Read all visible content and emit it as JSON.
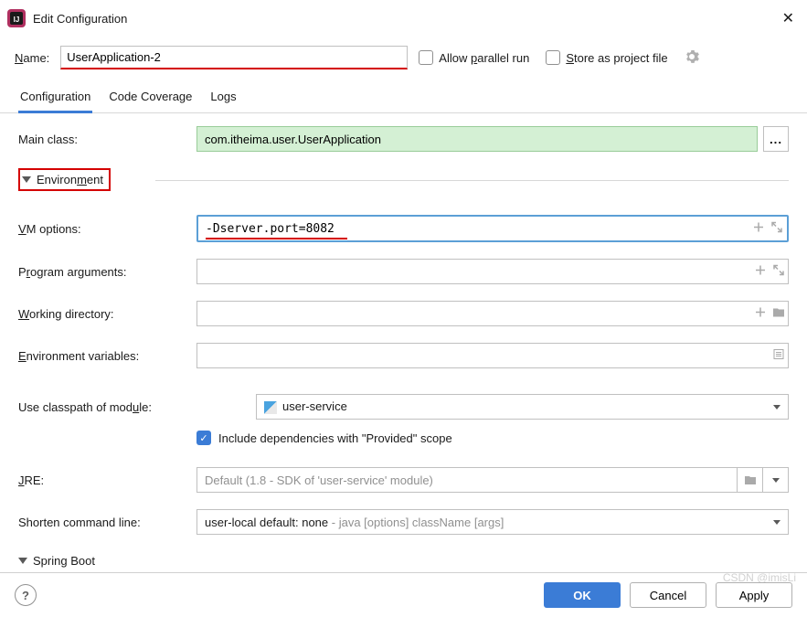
{
  "title": "Edit Configuration",
  "name_label": "Name:",
  "name_value": "UserApplication-2",
  "allow_parallel_label": "Allow parallel run",
  "store_project_label": "Store as project file",
  "tabs": {
    "configuration": "Configuration",
    "code_coverage": "Code Coverage",
    "logs": "Logs"
  },
  "form": {
    "main_class_label": "Main class:",
    "main_class_value": "com.itheima.user.UserApplication",
    "environment_label": "Environment",
    "vm_options_label": "VM options:",
    "vm_options_value": "-Dserver.port=8082",
    "program_args_label": "Program arguments:",
    "program_args_value": "",
    "working_dir_label": "Working directory:",
    "working_dir_value": "",
    "env_vars_label": "Environment variables:",
    "env_vars_value": "",
    "classpath_label": "Use classpath of module:",
    "classpath_value": "user-service",
    "include_deps_label": "Include dependencies with \"Provided\" scope",
    "jre_label": "JRE:",
    "jre_value": "Default (1.8 - SDK of 'user-service' module)",
    "shorten_label": "Shorten command line:",
    "shorten_value_main": "user-local default: none",
    "shorten_value_hint": " - java [options] className [args]",
    "spring_boot_label": "Spring Boot"
  },
  "buttons": {
    "ok": "OK",
    "cancel": "Cancel",
    "apply": "Apply",
    "help": "?"
  },
  "watermark": "CSDN @imisLi"
}
